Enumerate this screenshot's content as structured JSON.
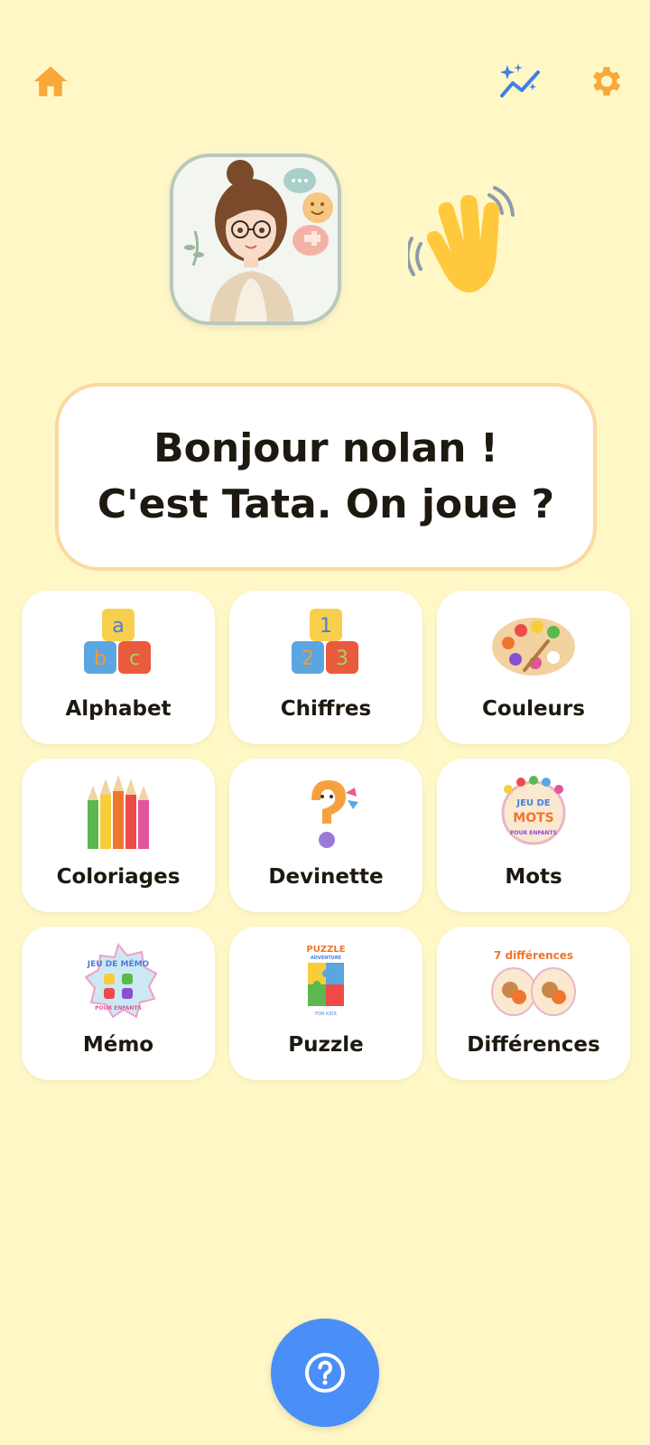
{
  "toolbar": {
    "home_icon": "home-icon",
    "stats_icon": "sparkle-chart-icon",
    "settings_icon": "gear-icon"
  },
  "header": {
    "greeting": "Bonjour nolan ! C'est Tata. On joue ?",
    "avatar": "tata-avatar",
    "wave_icon": "waving-hand-icon"
  },
  "games": [
    {
      "label": "Alphabet",
      "icon": "alphabet-blocks-icon"
    },
    {
      "label": "Chiffres",
      "icon": "number-blocks-icon"
    },
    {
      "label": "Couleurs",
      "icon": "paint-palette-icon"
    },
    {
      "label": "Coloriages",
      "icon": "colored-pencils-icon"
    },
    {
      "label": "Devinette",
      "icon": "question-mark-icon"
    },
    {
      "label": "Mots",
      "icon": "word-game-logo-icon"
    },
    {
      "label": "Mémo",
      "icon": "memo-game-logo-icon"
    },
    {
      "label": "Puzzle",
      "icon": "puzzle-logo-icon"
    },
    {
      "label": "Différences",
      "icon": "differences-logo-icon"
    }
  ],
  "logos": {
    "mots": [
      "JEU DE",
      "MOTS",
      "POUR ENFANTS"
    ],
    "memo": [
      "JEU DE MÉMO",
      "POUR ENFANTS"
    ],
    "puzzle": [
      "PUZZLE",
      "ADVENTURE",
      "FOR KIDS"
    ],
    "differences": [
      "7 différences"
    ]
  },
  "help": {
    "icon": "help-circle-icon"
  },
  "colors": {
    "background": "#fff7c6",
    "accent_orange": "#f8a93a",
    "accent_blue": "#4a8ff7",
    "bubble_border": "#fbd9a1"
  }
}
